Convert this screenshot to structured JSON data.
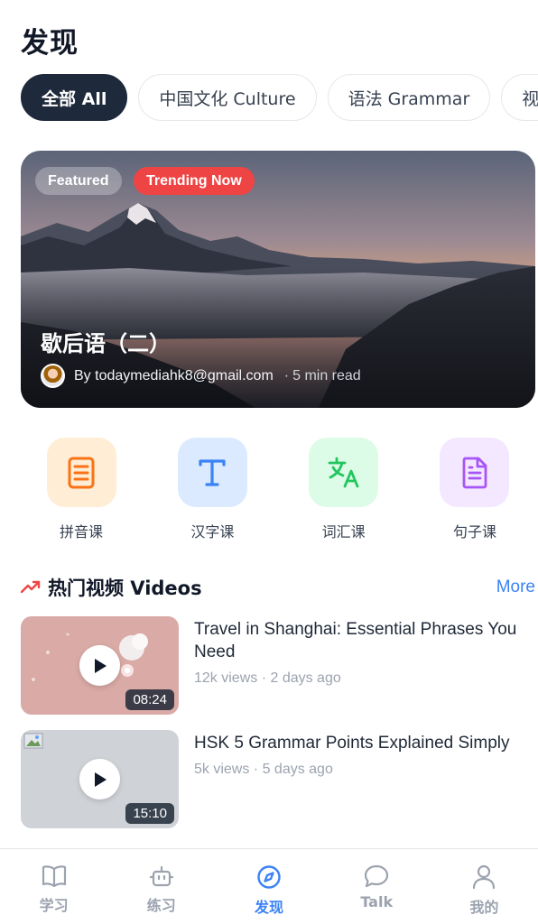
{
  "header": {
    "title": "发现"
  },
  "filters": [
    {
      "label": "全部 All",
      "active": true
    },
    {
      "label": "中国文化 Culture",
      "active": false
    },
    {
      "label": "语法 Grammar",
      "active": false
    },
    {
      "label": "视频",
      "active": false
    }
  ],
  "featured": {
    "badge_featured": "Featured",
    "badge_trending": "Trending Now",
    "title": "歇后语（二）",
    "author": "By todaymediahk8@gmail.com",
    "separator": "·",
    "read_time": "5 min read"
  },
  "categories": [
    {
      "label": "拼音课",
      "icon": "book-icon",
      "bg": "#ffedd5",
      "color": "#f97316"
    },
    {
      "label": "汉字课",
      "icon": "text-t-icon",
      "bg": "#dbeafe",
      "color": "#3b82f6"
    },
    {
      "label": "词汇课",
      "icon": "translate-icon",
      "bg": "#dcfce7",
      "color": "#22c55e"
    },
    {
      "label": "句子课",
      "icon": "document-icon",
      "bg": "#f3e8ff",
      "color": "#a855f7"
    }
  ],
  "videos_section": {
    "title": "热门视频 Videos",
    "more": "More",
    "items": [
      {
        "title": "Travel in Shanghai: Essential Phrases You Need",
        "views": "12k views · 2 days ago",
        "duration": "08:24"
      },
      {
        "title": "HSK 5 Grammar Points Explained Simply",
        "views": "5k views · 5 days ago",
        "duration": "15:10"
      }
    ]
  },
  "tabbar": [
    {
      "label": "学习",
      "icon": "open-book-icon",
      "active": false
    },
    {
      "label": "练习",
      "icon": "robot-icon",
      "active": false
    },
    {
      "label": "发现",
      "icon": "compass-icon",
      "active": true
    },
    {
      "label": "Talk",
      "icon": "chat-bubble-icon",
      "active": false
    },
    {
      "label": "我的",
      "icon": "user-icon",
      "active": false
    }
  ],
  "colors": {
    "accent": "#3b82f6",
    "trending": "#ef4444",
    "dark_chip": "#1e293b"
  }
}
